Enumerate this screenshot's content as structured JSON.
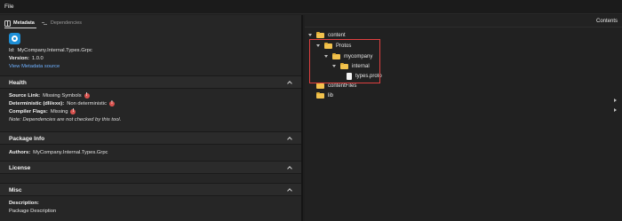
{
  "menubar": {
    "file_label": "File"
  },
  "tabs": [
    {
      "label": "Metadata"
    },
    {
      "label": "Dependencies"
    }
  ],
  "metadata": {
    "id_label": "Id:",
    "id_value": "MyCompany.Internal.Types.Grpc",
    "version_label": "Version:",
    "version_value": "1.0.0",
    "view_source_link": "View Metadata source"
  },
  "sections": {
    "health": {
      "title": "Health",
      "source_link_label": "Source Link:",
      "source_link_value": "Missing Symbols",
      "deterministic_label": "Deterministic (dll/exe):",
      "deterministic_value": "Non deterministic",
      "compiler_flags_label": "Compiler Flags:",
      "compiler_flags_value": "Missing",
      "note": "Note: Dependencies are not checked by this tool."
    },
    "package_info": {
      "title": "Package Info",
      "authors_label": "Authors:",
      "authors_value": "MyCompany.Internal.Types.Grpc"
    },
    "license": {
      "title": "License"
    },
    "misc": {
      "title": "Misc",
      "description_label": "Description:",
      "description_value": "Package Description"
    }
  },
  "contents": {
    "header": "Contents",
    "tree": [
      {
        "label": "content",
        "type": "folder",
        "expanded": true
      },
      {
        "label": "Protos",
        "type": "folder",
        "expanded": true
      },
      {
        "label": "mycompany",
        "type": "folder",
        "expanded": true
      },
      {
        "label": "internal",
        "type": "folder",
        "expanded": true
      },
      {
        "label": "types.proto",
        "type": "file"
      },
      {
        "label": "contentFiles",
        "type": "folder",
        "expanded": false
      },
      {
        "label": "lib",
        "type": "folder",
        "expanded": false
      }
    ]
  },
  "colors": {
    "accent_link": "#6fb1ff",
    "warning": "#d9534f",
    "highlight_box": "#e04040",
    "folder": "#f2c24d"
  }
}
